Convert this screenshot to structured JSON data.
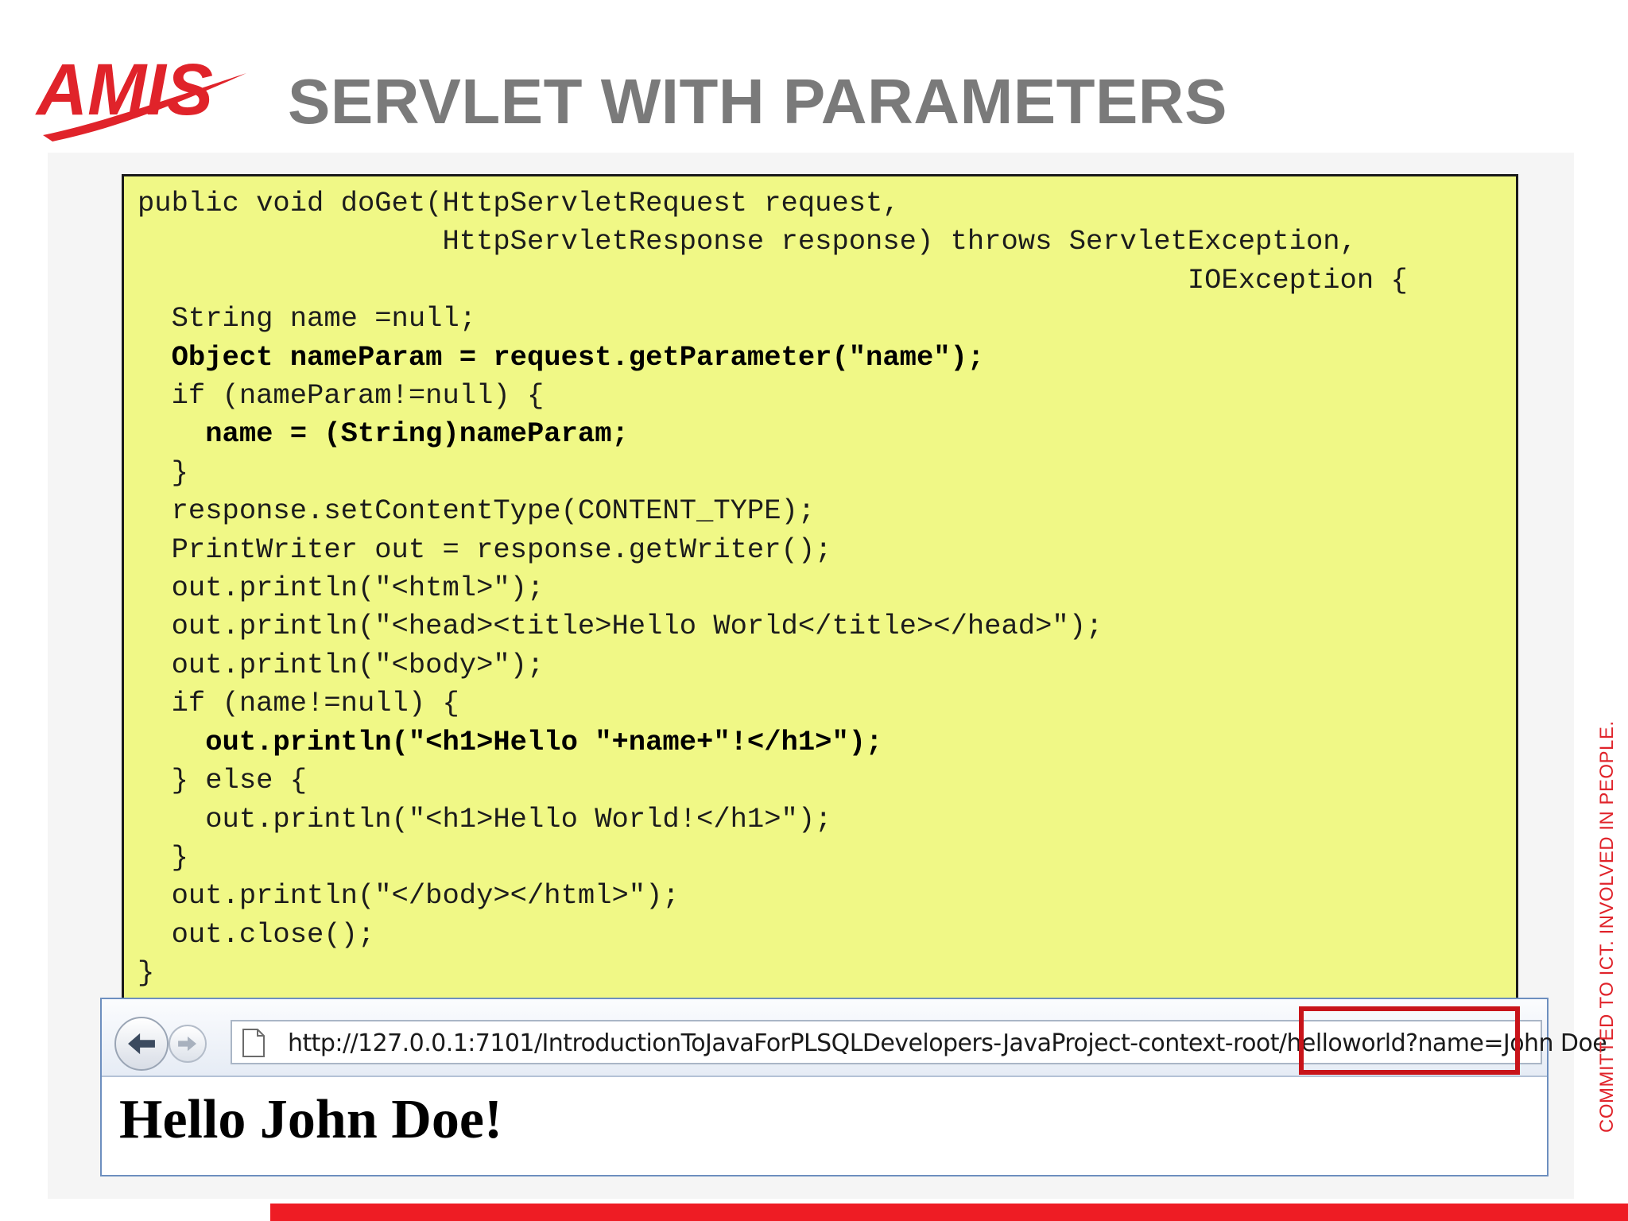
{
  "brand": {
    "logo_text": "AMIS",
    "accent_color": "#e0232a"
  },
  "slide": {
    "title": "SERVLET WITH PARAMETERS"
  },
  "code": {
    "lines": [
      {
        "text": "public void doGet(HttpServletRequest request,",
        "bold": false
      },
      {
        "text": "                  HttpServletResponse response) throws ServletException,",
        "bold": false
      },
      {
        "text": "                                                              IOException {",
        "bold": false
      },
      {
        "text": "  String name =null;",
        "bold": false
      },
      {
        "text": "  Object nameParam = request.getParameter(\"name\");",
        "bold": true
      },
      {
        "text": "  if (nameParam!=null) {",
        "bold": false
      },
      {
        "text": "    name = (String)nameParam;",
        "bold": true
      },
      {
        "text": "  }",
        "bold": false
      },
      {
        "text": "  response.setContentType(CONTENT_TYPE);",
        "bold": false
      },
      {
        "text": "  PrintWriter out = response.getWriter();",
        "bold": false
      },
      {
        "text": "  out.println(\"<html>\");",
        "bold": false
      },
      {
        "text": "  out.println(\"<head><title>Hello World</title></head>\");",
        "bold": false
      },
      {
        "text": "  out.println(\"<body>\");",
        "bold": false
      },
      {
        "text": "  if (name!=null) {",
        "bold": false
      },
      {
        "text": "    out.println(\"<h1>Hello \"+name+\"!</h1>\");",
        "bold": true
      },
      {
        "text": "  } else {",
        "bold": false
      },
      {
        "text": "    out.println(\"<h1>Hello World!</h1>\");",
        "bold": false
      },
      {
        "text": "  }",
        "bold": false
      },
      {
        "text": "  out.println(\"</body></html>\");",
        "bold": false
      },
      {
        "text": "  out.close();",
        "bold": false
      },
      {
        "text": "}",
        "bold": false
      }
    ]
  },
  "browser": {
    "url": "http://127.0.0.1:7101/IntroductionToJavaForPLSQLDevelopers-JavaProject-context-root/helloworld?name=John Doe",
    "page_heading": "Hello John Doe!",
    "back_icon": "arrow-left-icon",
    "forward_icon": "arrow-right-icon",
    "page_icon": "page-icon"
  },
  "sidebar_tagline": "COMMITTED TO ICT. INVOLVED IN PEOPLE."
}
